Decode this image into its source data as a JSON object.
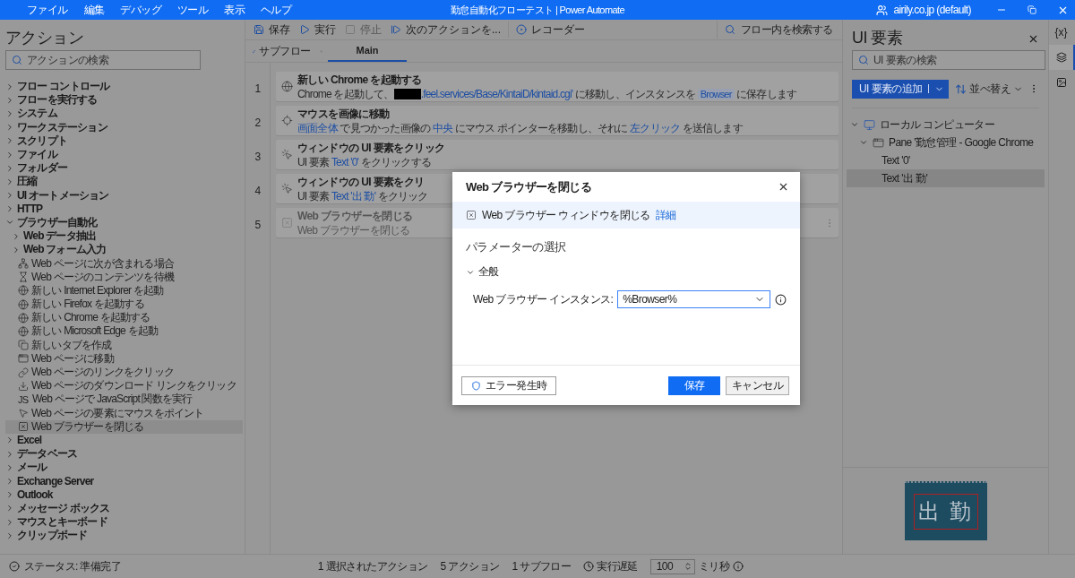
{
  "window": {
    "title": "勤怠自動化フローテスト | Power Automate",
    "account": "airily.co.jp (default)"
  },
  "menu": [
    "ファイル",
    "編集",
    "デバッグ",
    "ツール",
    "表示",
    "ヘルプ"
  ],
  "actions_panel": {
    "title": "アクション",
    "search": {
      "placeholder": "アクションの検索"
    },
    "tree": [
      {
        "label": "フロー コントロール",
        "kind": "group",
        "expanded": false,
        "selected": false
      },
      {
        "label": "フローを実行する",
        "kind": "group",
        "expanded": false,
        "selected": false
      },
      {
        "label": "システム",
        "kind": "group",
        "expanded": false,
        "selected": false
      },
      {
        "label": "ワークステーション",
        "kind": "group",
        "expanded": false,
        "selected": false
      },
      {
        "label": "スクリプト",
        "kind": "group",
        "expanded": false,
        "selected": false
      },
      {
        "label": "ファイル",
        "kind": "group",
        "expanded": false,
        "selected": false
      },
      {
        "label": "フォルダー",
        "kind": "group",
        "expanded": false,
        "selected": false
      },
      {
        "label": "圧縮",
        "kind": "group",
        "expanded": false,
        "selected": false
      },
      {
        "label": "UI オートメーション",
        "kind": "group",
        "expanded": false,
        "selected": false
      },
      {
        "label": "HTTP",
        "kind": "group",
        "expanded": false,
        "selected": false
      },
      {
        "label": "ブラウザー自動化",
        "kind": "group",
        "expanded": true,
        "selected": false,
        "children": [
          {
            "label": "Web データ抽出",
            "kind": "group",
            "expanded": false,
            "selected": false
          },
          {
            "label": "Web フォーム入力",
            "kind": "group",
            "expanded": false,
            "selected": false
          },
          {
            "label": "Web ページに次が含まれる場合",
            "kind": "action",
            "selected": false
          },
          {
            "label": "Web ページのコンテンツを待機",
            "kind": "action",
            "selected": false
          },
          {
            "label": "新しい Internet Explorer を起動",
            "kind": "action",
            "selected": false
          },
          {
            "label": "新しい Firefox を起動する",
            "kind": "action",
            "selected": false
          },
          {
            "label": "新しい Chrome を起動する",
            "kind": "action",
            "selected": false
          },
          {
            "label": "新しい Microsoft Edge を起動",
            "kind": "action",
            "selected": false
          },
          {
            "label": "新しいタブを作成",
            "kind": "action",
            "selected": false
          },
          {
            "label": "Web ページに移動",
            "kind": "action",
            "selected": false
          },
          {
            "label": "Web ページのリンクをクリック",
            "kind": "action",
            "selected": false
          },
          {
            "label": "Web ページのダウンロード リンクをクリック",
            "kind": "action",
            "selected": false
          },
          {
            "label": "Web ページで JavaScript 関数を実行",
            "kind": "action",
            "selected": false,
            "badge": "JS"
          },
          {
            "label": "Web ページの要素にマウスをポイント",
            "kind": "action",
            "selected": false
          },
          {
            "label": "Web ブラウザーを閉じる",
            "kind": "action",
            "selected": true
          }
        ]
      },
      {
        "label": "Excel",
        "kind": "group",
        "expanded": false,
        "selected": false
      },
      {
        "label": "データベース",
        "kind": "group",
        "expanded": false,
        "selected": false
      },
      {
        "label": "メール",
        "kind": "group",
        "expanded": false,
        "selected": false
      },
      {
        "label": "Exchange Server",
        "kind": "group",
        "expanded": false,
        "selected": false
      },
      {
        "label": "Outlook",
        "kind": "group",
        "expanded": false,
        "selected": false
      },
      {
        "label": "メッセージ ボックス",
        "kind": "group",
        "expanded": false,
        "selected": false
      },
      {
        "label": "マウスとキーボード",
        "kind": "group",
        "expanded": false,
        "selected": false
      },
      {
        "label": "クリップボード",
        "kind": "group",
        "expanded": false,
        "selected": false
      }
    ]
  },
  "toolbar": {
    "buttons": [
      {
        "label": "保存",
        "disabled": false
      },
      {
        "label": "実行",
        "disabled": false
      },
      {
        "label": "停止",
        "disabled": true
      },
      {
        "label": "次のアクションを...",
        "disabled": false
      },
      {
        "label": "レコーダー",
        "disabled": false
      }
    ],
    "search": {
      "placeholder": "フロー内を検索する"
    }
  },
  "subflow": {
    "label": "サブフロー",
    "tabs": [
      {
        "label": "Main",
        "selected": true
      }
    ]
  },
  "steps": [
    {
      "number": "1",
      "title": "新しい Chrome を起動する",
      "disabled": false,
      "hovered": false,
      "description": [
        {
          "kind": "text",
          "text": "Chrome を起動して、"
        },
        {
          "kind": "redacted"
        },
        {
          "kind": "link",
          "text": ".feel.services/Base/KintaiD/kintaid.cgi'"
        },
        {
          "kind": "text",
          "text": " に移動し、インスタンスを "
        },
        {
          "kind": "variable",
          "text": "Browser"
        },
        {
          "kind": "text",
          "text": " に保存します"
        }
      ]
    },
    {
      "number": "2",
      "title": "マウスを画像に移動",
      "disabled": false,
      "hovered": false,
      "description": [
        {
          "kind": "link",
          "text": "画面全体"
        },
        {
          "kind": "text",
          "text": " で見つかった画像の "
        },
        {
          "kind": "link",
          "text": "中央"
        },
        {
          "kind": "text",
          "text": " にマウス ポインターを移動し、それに "
        },
        {
          "kind": "link",
          "text": "左クリック"
        },
        {
          "kind": "text",
          "text": " を送信します"
        }
      ]
    },
    {
      "number": "3",
      "title": "ウィンドウの UI 要素をクリック",
      "disabled": false,
      "hovered": false,
      "description": [
        {
          "kind": "text",
          "text": "UI 要素 "
        },
        {
          "kind": "link",
          "text": "Text '0'"
        },
        {
          "kind": "text",
          "text": " をクリックする"
        }
      ]
    },
    {
      "number": "4",
      "title": "ウィンドウの UI 要素をクリ",
      "disabled": false,
      "hovered": false,
      "description": [
        {
          "kind": "text",
          "text": "UI 要素 "
        },
        {
          "kind": "link",
          "text": "Text '出 勤'"
        },
        {
          "kind": "text",
          "text": " をクリック"
        }
      ]
    },
    {
      "number": "5",
      "title": "Web ブラウザーを閉じる",
      "disabled": true,
      "hovered": true,
      "description": [
        {
          "kind": "text",
          "text": "Web ブラウザーを閉じる"
        }
      ]
    }
  ],
  "ui_panel": {
    "title": "UI 要素",
    "search": {
      "placeholder": "UI 要素の検索"
    },
    "add_button": "UI 要素の追加",
    "sort": "並べ替え",
    "tree": [
      {
        "label": "ローカル コンピューター",
        "expanded": true,
        "selected": false,
        "children": [
          {
            "label": "Pane '勤怠管理 - Google Chrome",
            "expanded": true,
            "selected": false,
            "children": [
              {
                "label": "Text '0'",
                "selected": false
              },
              {
                "label": "Text '出 勤'",
                "selected": true
              }
            ]
          }
        ]
      }
    ],
    "preview": {
      "text": "出 勤"
    }
  },
  "side_rail": [
    {
      "label": "{x}",
      "selected": false
    },
    {
      "selected": true
    },
    {
      "selected": false
    }
  ],
  "status_bar": {
    "status": "ステータス: 準備完了",
    "selected_actions": "1 選択されたアクション",
    "actions": "5 アクション",
    "subflows": "1 サブフロー",
    "delay_label": "実行遅延",
    "delay_value": "100",
    "delay_unit": "ミリ秒"
  },
  "dialog": {
    "title": "Web ブラウザーを閉じる",
    "info": {
      "text": "Web ブラウザー ウィンドウを閉じる",
      "link": "詳細"
    },
    "section": "パラメーターの選択",
    "group": {
      "label": "全般",
      "expanded": true
    },
    "fields": [
      {
        "label": "Web ブラウザー インスタンス:",
        "value": "%Browser%"
      }
    ],
    "error_button": "エラー発生時",
    "buttons": [
      {
        "label": "保存",
        "kind": "primary"
      },
      {
        "label": "キャンセル",
        "kind": "secondary"
      }
    ]
  }
}
